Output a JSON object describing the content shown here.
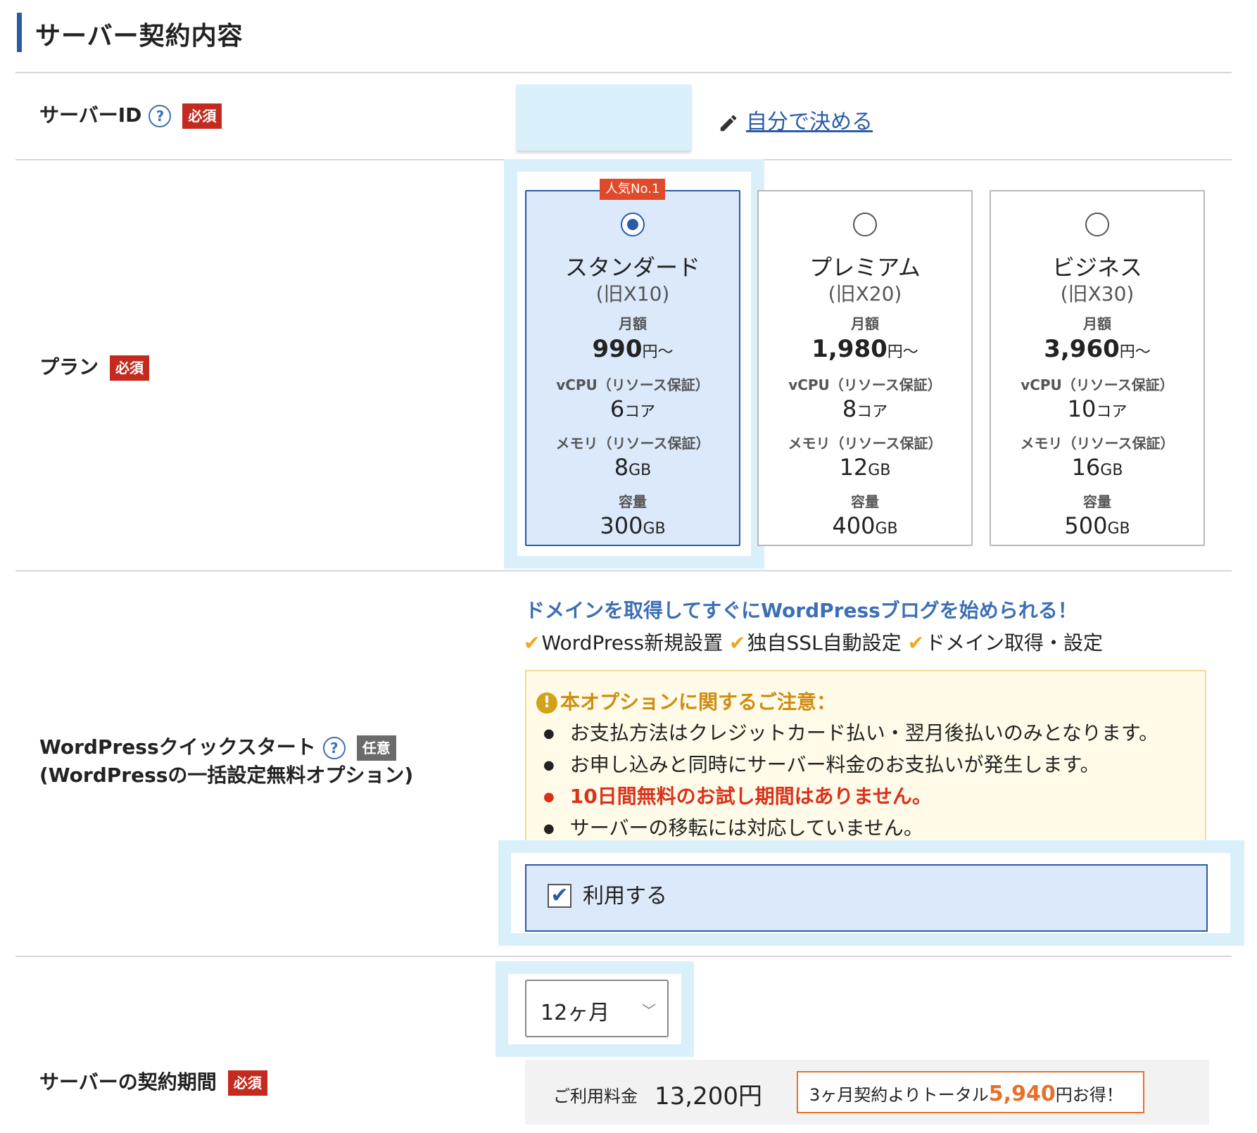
{
  "section": {
    "title": "サーバー契約内容"
  },
  "server_id": {
    "label": "サーバーID",
    "required_badge": "必須",
    "input_value": "",
    "decide_link": "自分で決める"
  },
  "plan": {
    "label": "プラン",
    "required_badge": "必須",
    "popular_badge": "人気No.1",
    "cards": [
      {
        "name": "スタンダード",
        "old": "(旧X10)",
        "monthly_label": "月額",
        "price": "990",
        "price_unit": "円〜",
        "vcpu_label": "vCPU（リソース保証）",
        "vcpu": "6",
        "vcpu_unit": "コア",
        "mem_label": "メモリ（リソース保証）",
        "mem": "8",
        "mem_unit": "GB",
        "disk_label": "容量",
        "disk": "300",
        "disk_unit": "GB",
        "selected": true
      },
      {
        "name": "プレミアム",
        "old": "(旧X20)",
        "monthly_label": "月額",
        "price": "1,980",
        "price_unit": "円〜",
        "vcpu_label": "vCPU（リソース保証）",
        "vcpu": "8",
        "vcpu_unit": "コア",
        "mem_label": "メモリ（リソース保証）",
        "mem": "12",
        "mem_unit": "GB",
        "disk_label": "容量",
        "disk": "400",
        "disk_unit": "GB",
        "selected": false
      },
      {
        "name": "ビジネス",
        "old": "(旧X30)",
        "monthly_label": "月額",
        "price": "3,960",
        "price_unit": "円〜",
        "vcpu_label": "vCPU（リソース保証）",
        "vcpu": "10",
        "vcpu_unit": "コア",
        "mem_label": "メモリ（リソース保証）",
        "mem": "16",
        "mem_unit": "GB",
        "disk_label": "容量",
        "disk": "500",
        "disk_unit": "GB",
        "selected": false
      }
    ]
  },
  "wordpress": {
    "label_line1": "WordPressクイックスタート",
    "label_line2": "(WordPressの一括設定無料オプション)",
    "optional_badge": "任意",
    "headline": "ドメインを取得してすぐにWordPressブログを始められる！",
    "features": [
      "WordPress新規設置",
      "独自SSL自動設定",
      "ドメイン取得・設定"
    ],
    "notice_title": "本オプションに関するご注意：",
    "notice_items": [
      "お支払方法はクレジットカード払い・翌月後払いのみとなります。",
      "お申し込みと同時にサーバー料金のお支払いが発生します。",
      "10日間無料のお試し期間はありません。",
      "サーバーの移転には対応していません。"
    ],
    "use_label": "利用する",
    "use_checked": true
  },
  "period": {
    "label": "サーバーの契約期間",
    "required_badge": "必須",
    "selected": "12ヶ月",
    "fee_label": "ご利用料金",
    "fee_amount": "13,200円",
    "save_prefix": "3ヶ月契約よりトータル",
    "save_amount": "5,940",
    "save_suffix": "円お得！"
  },
  "colors": {
    "accent": "#2a5aa8",
    "required": "#c52a1e",
    "highlight": "#d9f0fb",
    "warning": "#d9321b",
    "saving": "#e8702a"
  }
}
